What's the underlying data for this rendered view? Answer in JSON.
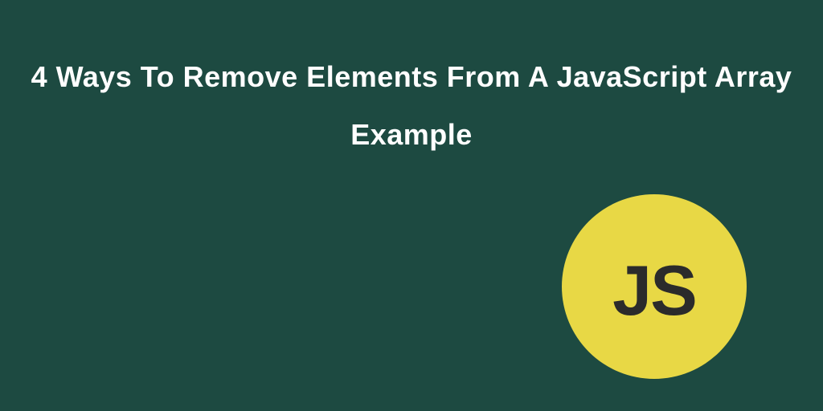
{
  "title": "4 Ways To Remove Elements From A JavaScript Array Example",
  "badge": {
    "text": "JS"
  },
  "colors": {
    "background": "#1d4a41",
    "badge_background": "#e8d845",
    "badge_text": "#2b2b2b",
    "title_text": "#ffffff"
  }
}
